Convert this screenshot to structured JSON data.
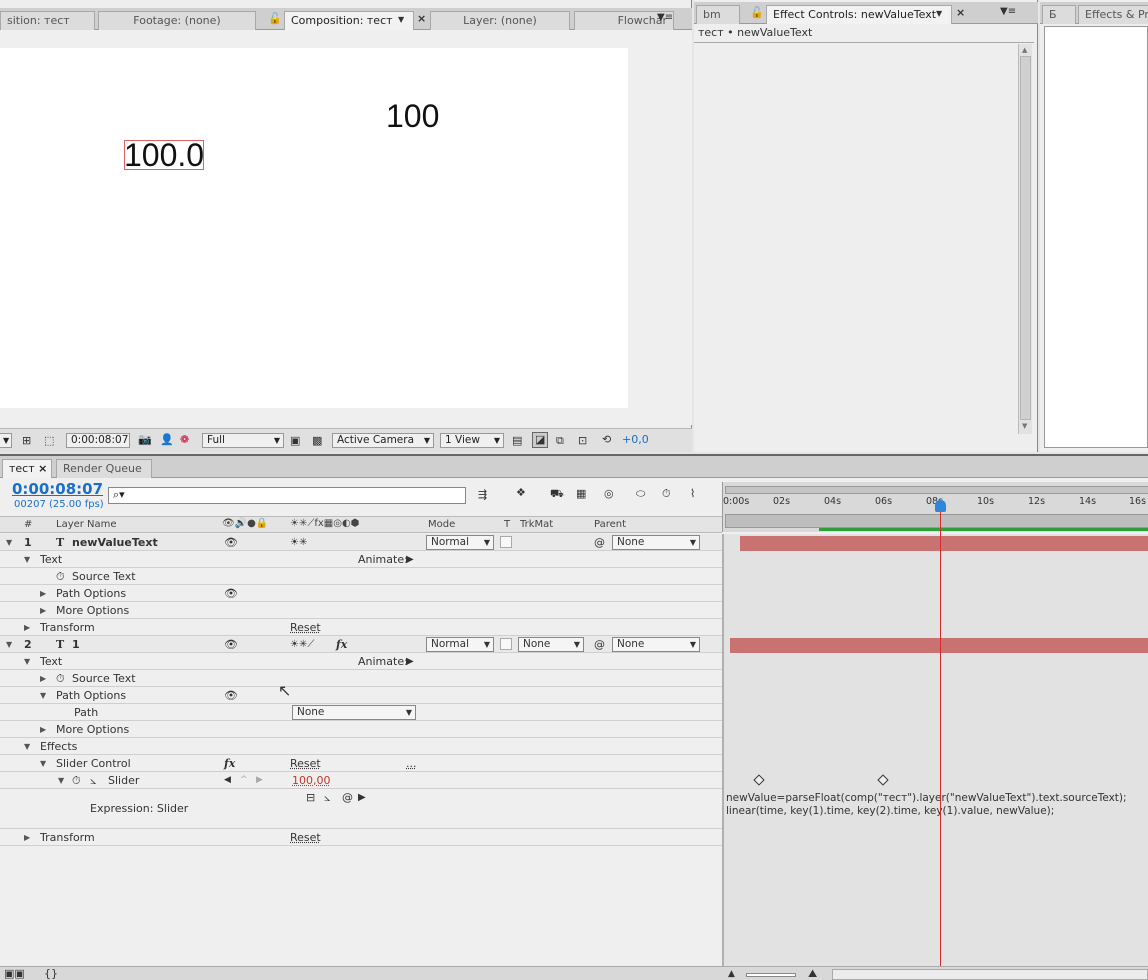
{
  "comp_panel": {
    "tabs": [
      {
        "label": "sition: тест"
      },
      {
        "label": "Footage: (none)"
      },
      {
        "label": "Composition: тест"
      },
      {
        "label": "Layer: (none)"
      },
      {
        "label": "Flowchar"
      }
    ],
    "canvas_text_a": "100",
    "canvas_text_b": "100.0",
    "toolbar": {
      "timecode": "0:00:08:07",
      "resolution": "Full",
      "camera": "Active Camera",
      "views": "1 View",
      "exposure": "+0,0"
    }
  },
  "effect_panel": {
    "tabs": [
      {
        "label": "bm"
      },
      {
        "label": "Effect Controls: newValueText"
      }
    ],
    "breadcrumb": "тест • newValueText"
  },
  "right_panel": {
    "tabs": [
      {
        "label": "Б"
      },
      {
        "label": "Effects & Pre"
      }
    ]
  },
  "timeline": {
    "tabs": [
      {
        "label": "тест"
      },
      {
        "label": "Render Queue"
      }
    ],
    "current_time": "0:00:08:07",
    "frame_info": "00207 (25.00 fps)",
    "search_placeholder": "",
    "headers": {
      "num": "#",
      "layer_name": "Layer Name",
      "mode": "Mode",
      "t": "T",
      "trkmat": "TrkMat",
      "parent": "Parent"
    },
    "ruler": [
      "0:00s",
      "02s",
      "04s",
      "06s",
      "08s",
      "10s",
      "12s",
      "14s",
      "16s"
    ],
    "layers": [
      {
        "num": "1",
        "type_icon": "T",
        "name": "newValueText",
        "mode": "Normal",
        "trkmat": "",
        "parent": "None"
      },
      {
        "num": "2",
        "type_icon": "T",
        "name": "1",
        "mode": "Normal",
        "trkmat": "None",
        "parent": "None"
      }
    ],
    "props": {
      "text": "Text",
      "animate": "Animate:",
      "source_text": "Source Text",
      "path_options": "Path Options",
      "more_options": "More Options",
      "transform": "Transform",
      "reset": "Reset",
      "path": "Path",
      "path_value": "None",
      "effects": "Effects",
      "slider_control": "Slider Control",
      "slider": "Slider",
      "slider_value": "100,00",
      "expression_label": "Expression: Slider",
      "ellipsis": "...",
      "expression_line1": "newValue=parseFloat(comp(\"тест\").layer(\"newValueText\").text.sourceText);",
      "expression_line2": "linear(time, key(1).time, key(2).time, key(1).value, newValue);"
    }
  },
  "colors": {
    "accent_blue": "#1a6fc9",
    "layer_bar": "#c87272",
    "playhead": "#d42a2a",
    "work_area": "#2f9e3a"
  }
}
